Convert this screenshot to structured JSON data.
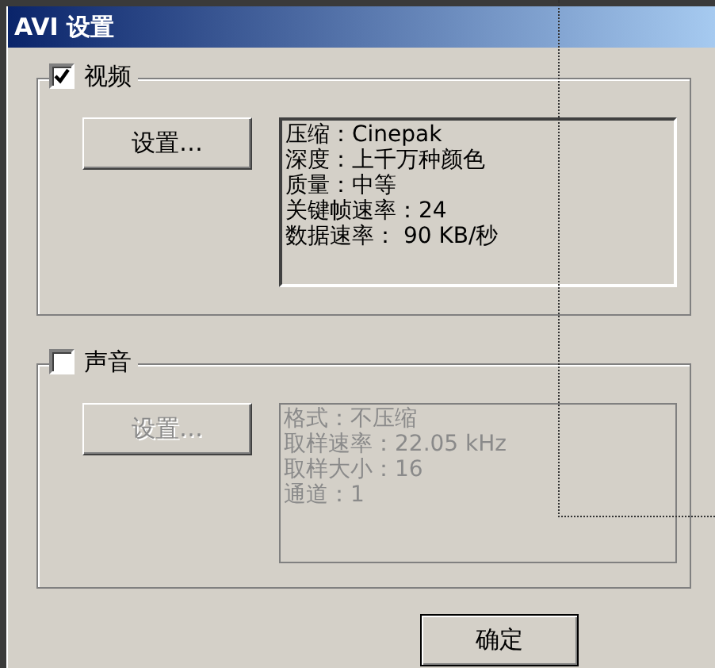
{
  "window": {
    "title": "AVI 设置"
  },
  "sections": [
    {
      "label": "视频",
      "checked": true,
      "disabled": false,
      "button": "设置…",
      "info_lines": [
        "压缩：Cinepak",
        "深度：上千万种颜色",
        "质量：中等",
        "关键帧速率：24",
        "数据速率： 90 KB/秒"
      ]
    },
    {
      "label": "声音",
      "checked": false,
      "disabled": true,
      "button": "设置…",
      "info_lines": [
        "格式：不压缩",
        "取样速率：22.05 kHz",
        "取样大小：16",
        "通道：1"
      ]
    }
  ],
  "buttons": [
    "确定"
  ]
}
